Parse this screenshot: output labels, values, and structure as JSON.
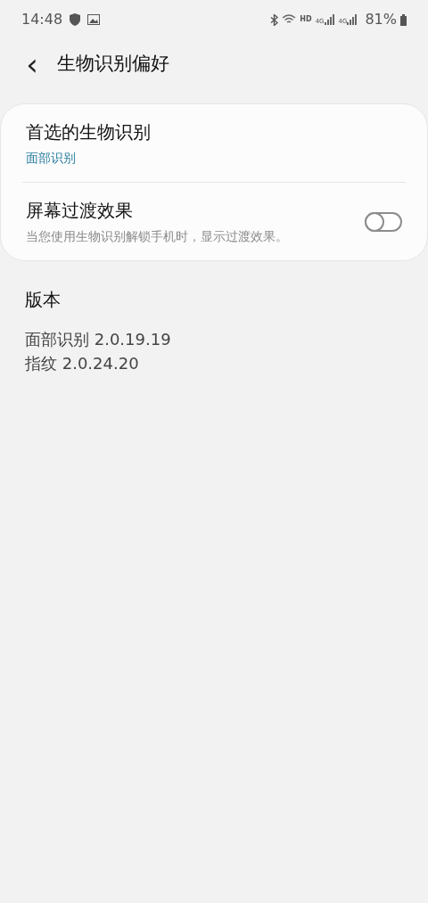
{
  "status_bar": {
    "time": "14:48",
    "hd": "HD",
    "network_labels": [
      "4G",
      "4G"
    ],
    "battery": "81%"
  },
  "header": {
    "back": "‹",
    "title": "生物识别偏好"
  },
  "settings": [
    {
      "kind": "link",
      "title": "首选的生物识别",
      "value": "面部识别"
    },
    {
      "kind": "switch",
      "title": "屏幕过渡效果",
      "description": "当您使用生物识别解锁手机时，显示过渡效果。",
      "on": false
    }
  ],
  "version": {
    "heading": "版本",
    "lines": [
      "面部识别 2.0.19.19",
      "指纹 2.0.24.20"
    ]
  }
}
